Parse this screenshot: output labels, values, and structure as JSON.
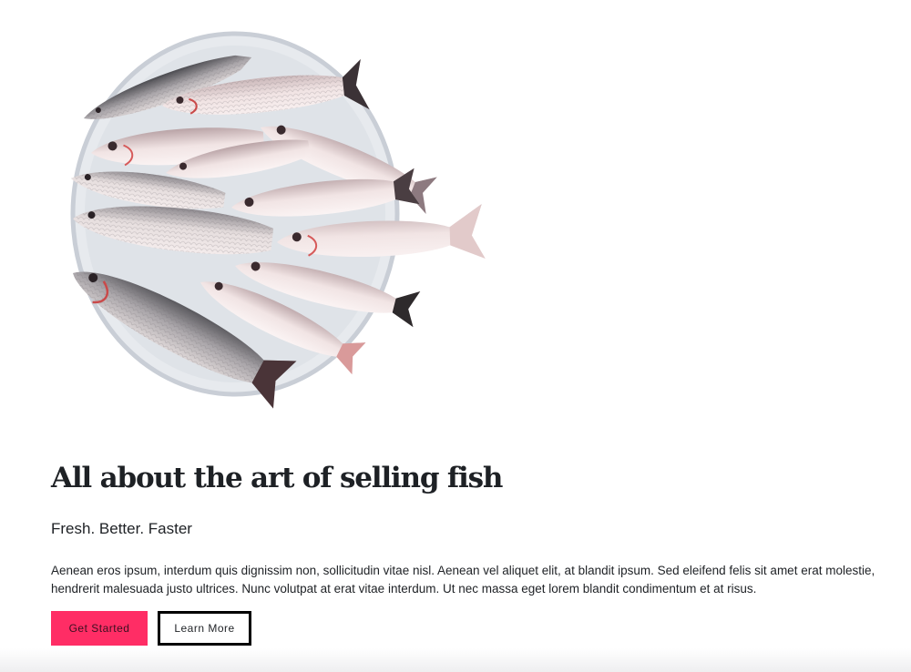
{
  "hero": {
    "image": "fish-on-plate-image",
    "title": "All about the art of selling fish",
    "subtitle": "Fresh. Better. Faster",
    "body": "Aenean eros ipsum, interdum quis dignissim non, sollicitudin vitae nisl. Aenean vel aliquet elit, at blandit ipsum. Sed eleifend felis sit amet erat molestie, hendrerit malesuada justo ultrices. Nunc volutpat at erat vitae interdum. Ut nec massa eget lorem blandit condimentum et at risus."
  },
  "buttons": {
    "primary_label": "Get Started",
    "secondary_label": "Learn More"
  },
  "colors": {
    "accent": "#ff2d65",
    "text": "#1e2125",
    "outline": "#000000"
  }
}
